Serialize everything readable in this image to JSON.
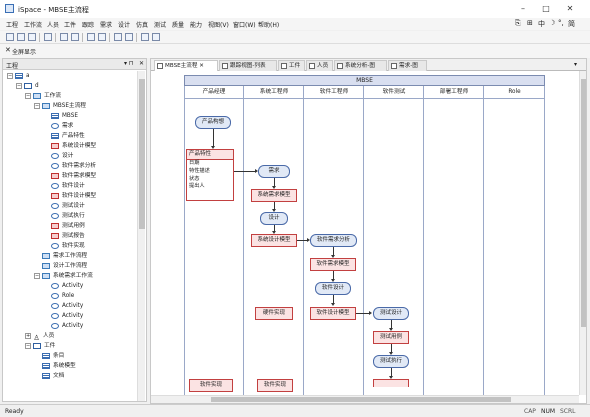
{
  "window": {
    "title": "iSpace - MBSE主流程"
  },
  "menu": [
    "工程",
    "工作流",
    "人员",
    "工件",
    "跟踪",
    "需求",
    "设计",
    "仿真",
    "测试",
    "质量",
    "能力",
    "视图(V)",
    "窗口(W)",
    "帮助(H)"
  ],
  "menu_right_tools": [
    "中",
    "简"
  ],
  "toolbar2": {
    "fullscreen_label": "全屏显示"
  },
  "left_panel": {
    "title": "工程",
    "tree": [
      {
        "label": "a",
        "level": 0,
        "exp": "−",
        "icon": "table"
      },
      {
        "label": "d",
        "level": 1,
        "exp": "−",
        "icon": "folder"
      },
      {
        "label": "工作流",
        "level": 2,
        "exp": "−",
        "icon": "flow"
      },
      {
        "label": "MBSE主流程",
        "level": 3,
        "exp": "−",
        "icon": "flow"
      },
      {
        "label": "MBSE",
        "level": 4,
        "icon": "table"
      },
      {
        "label": "需求",
        "level": 4,
        "icon": "ellipse"
      },
      {
        "label": "产品特性",
        "level": 4,
        "icon": "table"
      },
      {
        "label": "系统设计模型",
        "level": 4,
        "icon": "rect"
      },
      {
        "label": "设计",
        "level": 4,
        "icon": "ellipse"
      },
      {
        "label": "软件需求分析",
        "level": 4,
        "icon": "ellipse"
      },
      {
        "label": "软件需求模型",
        "level": 4,
        "icon": "rect"
      },
      {
        "label": "软件设计",
        "level": 4,
        "icon": "ellipse"
      },
      {
        "label": "软件设计模型",
        "level": 4,
        "icon": "rect"
      },
      {
        "label": "测试设计",
        "level": 4,
        "icon": "ellipse"
      },
      {
        "label": "测试执行",
        "level": 4,
        "icon": "ellipse"
      },
      {
        "label": "测试用例",
        "level": 4,
        "icon": "rect"
      },
      {
        "label": "测试报告",
        "level": 4,
        "icon": "rect"
      },
      {
        "label": "软件实现",
        "level": 4,
        "icon": "ellipse"
      },
      {
        "label": "需求工作流程",
        "level": 3,
        "icon": "flow"
      },
      {
        "label": "设计工作流程",
        "level": 3,
        "icon": "flow"
      },
      {
        "label": "系统需求工作流",
        "level": 3,
        "exp": "−",
        "icon": "flow"
      },
      {
        "label": "Activity",
        "level": 4,
        "icon": "ellipse"
      },
      {
        "label": "Role",
        "level": 4,
        "icon": "ellipse"
      },
      {
        "label": "Activity",
        "level": 4,
        "icon": "ellipse"
      },
      {
        "label": "Activity",
        "level": 4,
        "icon": "ellipse"
      },
      {
        "label": "Activity",
        "level": 4,
        "icon": "ellipse"
      },
      {
        "label": "人员",
        "level": 2,
        "exp": "+",
        "icon": "person"
      },
      {
        "label": "工件",
        "level": 2,
        "exp": "−",
        "icon": "folder"
      },
      {
        "label": "条目",
        "level": 3,
        "icon": "table"
      },
      {
        "label": "系统模型",
        "level": 3,
        "icon": "table"
      },
      {
        "label": "文档",
        "level": 3,
        "icon": "table"
      }
    ]
  },
  "tabs": [
    "MBSE主流程",
    "跟踪视图-列表",
    "工件",
    "人员",
    "系统分析-图",
    "需求-图"
  ],
  "diagram": {
    "title": "MBSE",
    "lanes": [
      "产品经理",
      "系统工程师",
      "软件工程师",
      "软件测试",
      "部署工程师",
      "Role"
    ],
    "prod_spec": {
      "header": "产品特性",
      "items": [
        "日期",
        "特性描述",
        "状态",
        "提出人"
      ]
    },
    "boxes": {
      "product_concept": "产品构想",
      "requirement": "需求",
      "sys_req_model": "系统需求模型",
      "design": "设计",
      "sys_design_model": "系统设计模型",
      "hardware_impl": "硬件实现",
      "sw_impl_1": "软件实现",
      "sw_impl_2": "软件实现",
      "sw_req_analysis": "软件需求分析",
      "sw_req_model": "软件需求模型",
      "sw_design": "软件设计",
      "sw_design_model": "软件设计模型",
      "test_design": "测试设计",
      "test_case": "测试用例",
      "test_exec": "测试执行"
    }
  },
  "status": {
    "left": "Ready",
    "indicators": [
      "CAP",
      "NUM",
      "SCRL"
    ]
  }
}
